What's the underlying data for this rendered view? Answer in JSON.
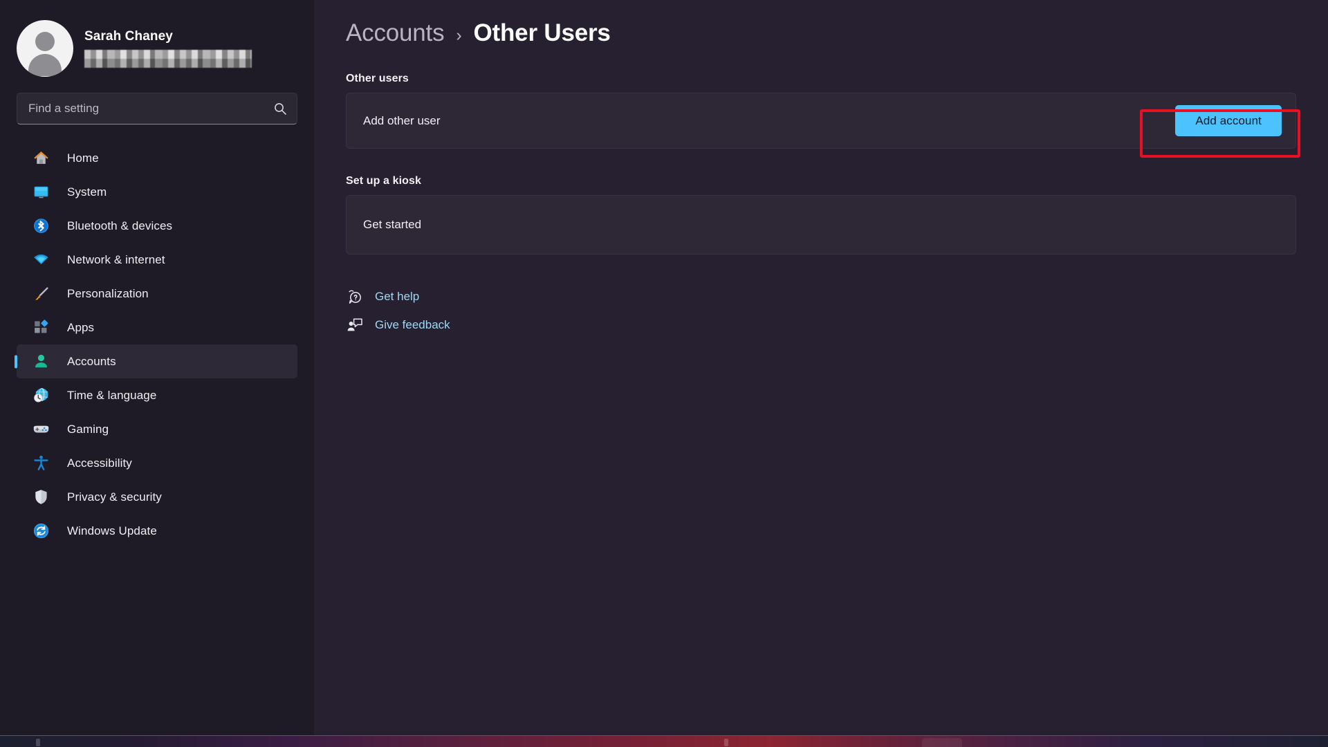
{
  "profile": {
    "name": "Sarah Chaney",
    "email_redacted": true,
    "avatar_icon": "person-avatar-icon"
  },
  "search": {
    "placeholder": "Find a setting",
    "value": "",
    "icon": "search-icon"
  },
  "sidebar": {
    "items": [
      {
        "label": "Home",
        "icon": "home-icon",
        "selected": false
      },
      {
        "label": "System",
        "icon": "monitor-icon",
        "selected": false
      },
      {
        "label": "Bluetooth & devices",
        "icon": "bluetooth-icon",
        "selected": false
      },
      {
        "label": "Network & internet",
        "icon": "wifi-icon",
        "selected": false
      },
      {
        "label": "Personalization",
        "icon": "paintbrush-icon",
        "selected": false
      },
      {
        "label": "Apps",
        "icon": "apps-grid-icon",
        "selected": false
      },
      {
        "label": "Accounts",
        "icon": "person-icon",
        "selected": true
      },
      {
        "label": "Time & language",
        "icon": "clock-globe-icon",
        "selected": false
      },
      {
        "label": "Gaming",
        "icon": "gamepad-icon",
        "selected": false
      },
      {
        "label": "Accessibility",
        "icon": "accessibility-icon",
        "selected": false
      },
      {
        "label": "Privacy & security",
        "icon": "shield-icon",
        "selected": false
      },
      {
        "label": "Windows Update",
        "icon": "update-refresh-icon",
        "selected": false
      }
    ]
  },
  "breadcrumb": {
    "parent": "Accounts",
    "separator": "›",
    "current": "Other Users"
  },
  "main": {
    "other_users": {
      "heading": "Other users",
      "row_label": "Add other user",
      "button_label": "Add account"
    },
    "kiosk": {
      "heading": "Set up a kiosk",
      "row_label": "Get started"
    },
    "links": [
      {
        "label": "Get help",
        "icon": "help-question-bubble-icon"
      },
      {
        "label": "Give feedback",
        "icon": "feedback-person-bubble-icon"
      }
    ]
  },
  "annotation": {
    "target": "Add account",
    "color": "#e81123"
  },
  "colors": {
    "accent": "#4cc2ff",
    "sidebar_bg": "#1f1b26",
    "content_bg": "#262030",
    "card_bg": "#2e2836",
    "link": "#9fd8f2",
    "highlight": "#e81123"
  }
}
